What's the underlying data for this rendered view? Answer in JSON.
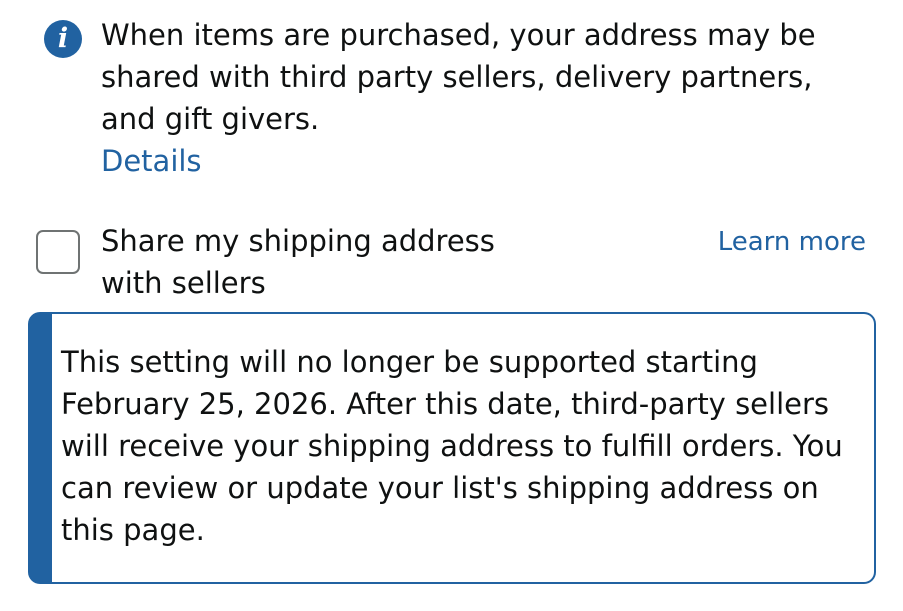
{
  "info": {
    "icon": "info-icon",
    "icon_glyph": "i",
    "text": "When items are purchased, your address may be shared with third party sellers, delivery partners, and gift givers.",
    "details_link": "Details"
  },
  "share_setting": {
    "checked": false,
    "label": "Share my shipping address with sellers",
    "learn_more": "Learn more"
  },
  "notice": {
    "text": "This setting will no longer be supported starting February 25, 2026. After this date, third-party sellers will receive your shipping address to fulfill orders. You can review or update your list's shipping address on this page."
  },
  "colors": {
    "accent": "#2162a1",
    "text": "#0f1111",
    "checkbox_border": "#6f7373",
    "background": "#ffffff"
  }
}
